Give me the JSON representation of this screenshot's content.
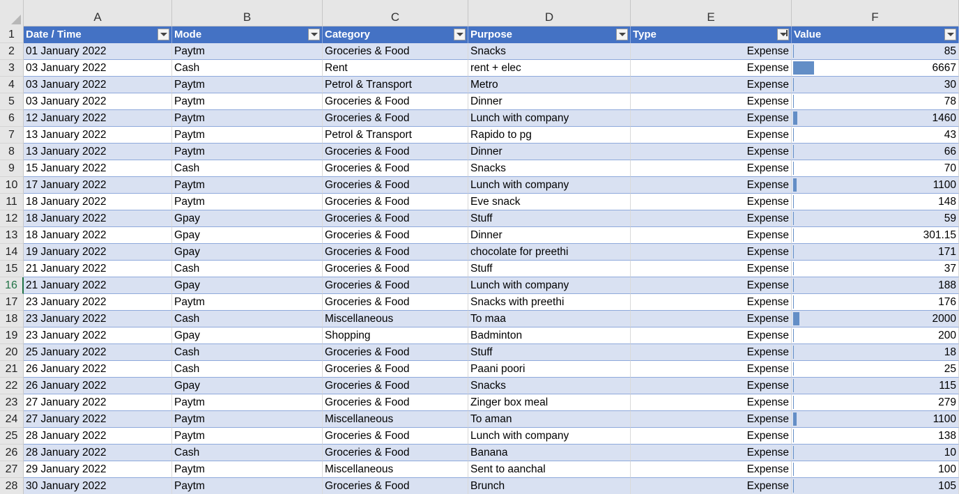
{
  "columns": [
    "A",
    "B",
    "C",
    "D",
    "E",
    "F"
  ],
  "header": {
    "row_number": "1",
    "cells": [
      "Date / Time",
      "Mode",
      "Category",
      "Purpose",
      "Type",
      "Value"
    ]
  },
  "rows": [
    {
      "n": "2",
      "date": "01 January 2022",
      "mode": "Paytm",
      "category": "Groceries & Food",
      "purpose": "Snacks",
      "type": "Expense",
      "value": "85"
    },
    {
      "n": "3",
      "date": "03 January 2022",
      "mode": "Cash",
      "category": "Rent",
      "purpose": "rent + elec",
      "type": "Expense",
      "value": "6667"
    },
    {
      "n": "4",
      "date": "03 January 2022",
      "mode": "Paytm",
      "category": "Petrol & Transport",
      "purpose": "Metro",
      "type": "Expense",
      "value": "30"
    },
    {
      "n": "5",
      "date": "03 January 2022",
      "mode": "Paytm",
      "category": "Groceries & Food",
      "purpose": "Dinner",
      "type": "Expense",
      "value": "78"
    },
    {
      "n": "6",
      "date": "12 January 2022",
      "mode": "Paytm",
      "category": "Groceries & Food",
      "purpose": "Lunch with company",
      "type": "Expense",
      "value": "1460"
    },
    {
      "n": "7",
      "date": "13 January 2022",
      "mode": "Paytm",
      "category": "Petrol & Transport",
      "purpose": "Rapido to pg",
      "type": "Expense",
      "value": "43"
    },
    {
      "n": "8",
      "date": "13 January 2022",
      "mode": "Paytm",
      "category": "Groceries & Food",
      "purpose": "Dinner",
      "type": "Expense",
      "value": "66"
    },
    {
      "n": "9",
      "date": "15 January 2022",
      "mode": "Cash",
      "category": "Groceries & Food",
      "purpose": "Snacks",
      "type": "Expense",
      "value": "70"
    },
    {
      "n": "10",
      "date": "17 January 2022",
      "mode": "Paytm",
      "category": "Groceries & Food",
      "purpose": "Lunch with company",
      "type": "Expense",
      "value": "1100"
    },
    {
      "n": "11",
      "date": "18 January 2022",
      "mode": "Paytm",
      "category": "Groceries & Food",
      "purpose": "Eve snack",
      "type": "Expense",
      "value": "148"
    },
    {
      "n": "12",
      "date": "18 January 2022",
      "mode": "Gpay",
      "category": "Groceries & Food",
      "purpose": "Stuff",
      "type": "Expense",
      "value": "59"
    },
    {
      "n": "13",
      "date": "18 January 2022",
      "mode": "Gpay",
      "category": "Groceries & Food",
      "purpose": "Dinner",
      "type": "Expense",
      "value": "301.15"
    },
    {
      "n": "14",
      "date": "19 January 2022",
      "mode": "Gpay",
      "category": "Groceries & Food",
      "purpose": "chocolate for preethi",
      "type": "Expense",
      "value": "171"
    },
    {
      "n": "15",
      "date": "21 January 2022",
      "mode": "Cash",
      "category": "Groceries & Food",
      "purpose": "Stuff",
      "type": "Expense",
      "value": "37"
    },
    {
      "n": "16",
      "date": "21 January 2022",
      "mode": "Gpay",
      "category": "Groceries & Food",
      "purpose": "Lunch with company",
      "type": "Expense",
      "value": "188"
    },
    {
      "n": "17",
      "date": "23 January 2022",
      "mode": "Paytm",
      "category": "Groceries & Food",
      "purpose": "Snacks with preethi",
      "type": "Expense",
      "value": "176"
    },
    {
      "n": "18",
      "date": "23 January 2022",
      "mode": "Cash",
      "category": "Miscellaneous",
      "purpose": "To maa",
      "type": "Expense",
      "value": "2000"
    },
    {
      "n": "19",
      "date": "23 January 2022",
      "mode": "Gpay",
      "category": "Shopping",
      "purpose": "Badminton",
      "type": "Expense",
      "value": "200"
    },
    {
      "n": "20",
      "date": "25 January 2022",
      "mode": "Cash",
      "category": "Groceries & Food",
      "purpose": "Stuff",
      "type": "Expense",
      "value": "18"
    },
    {
      "n": "21",
      "date": "26 January 2022",
      "mode": "Cash",
      "category": "Groceries & Food",
      "purpose": "Paani poori",
      "type": "Expense",
      "value": "25"
    },
    {
      "n": "22",
      "date": "26 January 2022",
      "mode": "Gpay",
      "category": "Groceries & Food",
      "purpose": "Snacks",
      "type": "Expense",
      "value": "115"
    },
    {
      "n": "23",
      "date": "27 January 2022",
      "mode": "Paytm",
      "category": "Groceries & Food",
      "purpose": "Zinger box meal",
      "type": "Expense",
      "value": "279"
    },
    {
      "n": "24",
      "date": "27 January 2022",
      "mode": "Paytm",
      "category": "Miscellaneous",
      "purpose": "To aman",
      "type": "Expense",
      "value": "1100"
    },
    {
      "n": "25",
      "date": "28 January 2022",
      "mode": "Paytm",
      "category": "Groceries & Food",
      "purpose": "Lunch with company",
      "type": "Expense",
      "value": "138"
    },
    {
      "n": "26",
      "date": "28 January 2022",
      "mode": "Cash",
      "category": "Groceries & Food",
      "purpose": "Banana",
      "type": "Expense",
      "value": "10"
    },
    {
      "n": "27",
      "date": "29 January 2022",
      "mode": "Paytm",
      "category": "Miscellaneous",
      "purpose": "Sent to aanchal",
      "type": "Expense",
      "value": "100"
    },
    {
      "n": "28",
      "date": "30 January 2022",
      "mode": "Paytm",
      "category": "Groceries & Food",
      "purpose": "Brunch",
      "type": "Expense",
      "value": "105"
    }
  ],
  "selected_row": "16",
  "colors": {
    "header_fill": "#4472c4",
    "band_fill": "#d9e1f2",
    "databar_fill": "#638ec6",
    "selection": "#217346"
  },
  "icons": {
    "filter": "filter-dropdown-icon",
    "sorted_filter": "sort-filter-icon",
    "select_all": "select-all-corner-icon"
  }
}
